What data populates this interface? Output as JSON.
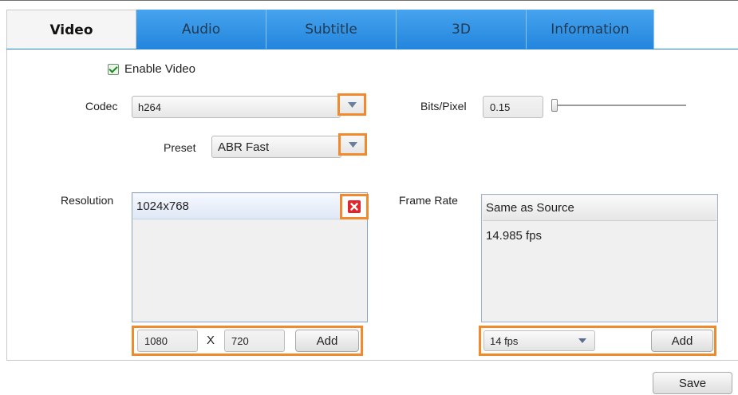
{
  "tabs": [
    {
      "label": "Video"
    },
    {
      "label": "Audio"
    },
    {
      "label": "Subtitle"
    },
    {
      "label": "3D"
    },
    {
      "label": "Information"
    }
  ],
  "enable_video": {
    "label": "Enable Video",
    "checked": true
  },
  "codec": {
    "label": "Codec",
    "value": "h264"
  },
  "preset": {
    "label": "Preset",
    "value": "ABR Fast"
  },
  "bits_per_pixel": {
    "label": "Bits/Pixel",
    "value": "0.15"
  },
  "resolution": {
    "label": "Resolution",
    "items": [
      "1024x768"
    ],
    "width_value": "1080",
    "separator": "X",
    "height_value": "720",
    "add_label": "Add"
  },
  "frame_rate": {
    "label": "Frame Rate",
    "items": [
      "Same as Source",
      "14.985 fps"
    ],
    "dropdown_value": "14 fps",
    "add_label": "Add"
  },
  "save_label": "Save",
  "colors": {
    "tab_blue": "#2385dc",
    "highlight_orange": "#f08a2c",
    "delete_red": "#e0262a"
  }
}
